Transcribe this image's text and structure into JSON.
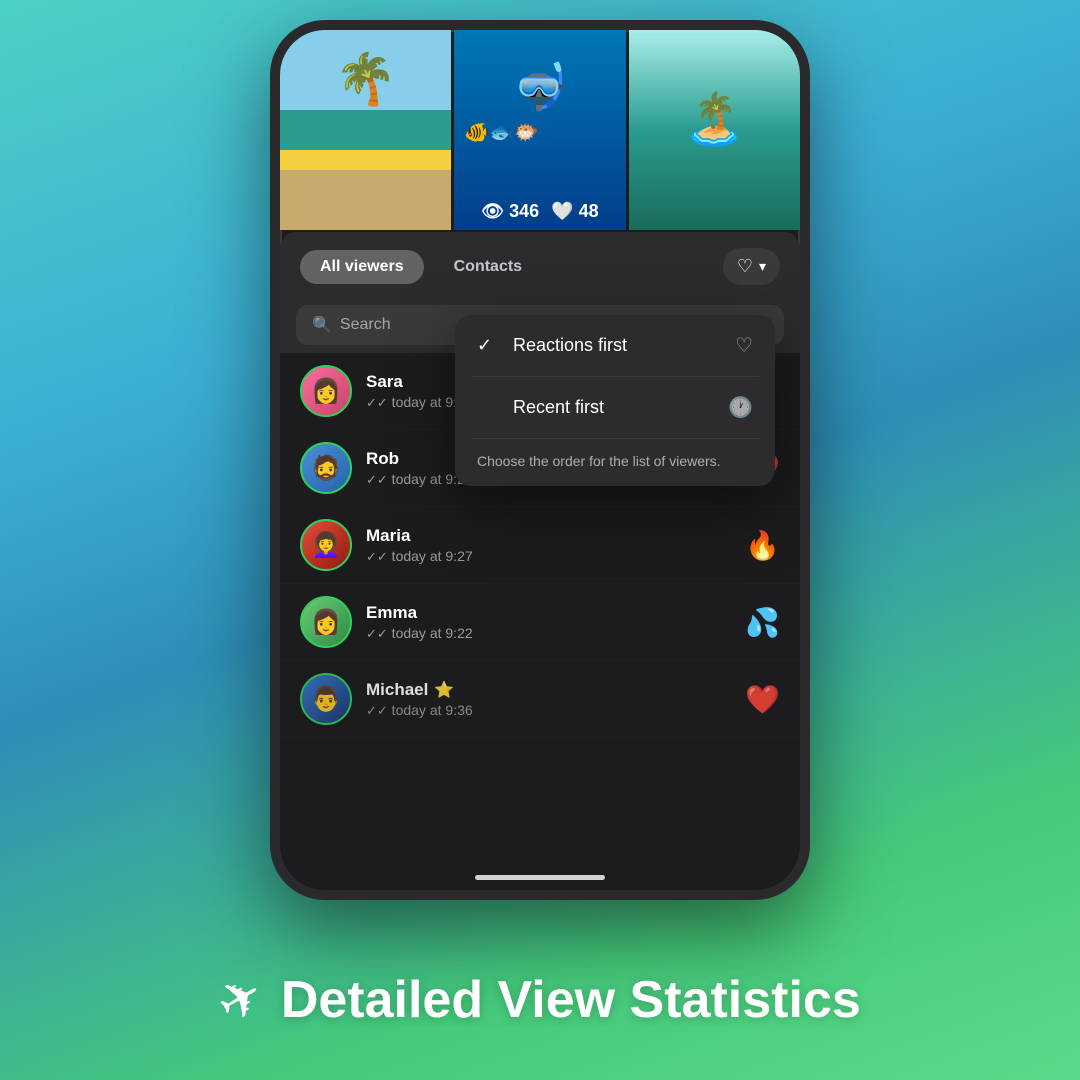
{
  "background": {
    "gradient_start": "#4ecdc4",
    "gradient_end": "#5bd98a"
  },
  "phone": {
    "media": {
      "items": [
        {
          "type": "beach",
          "label": "beach-scene"
        },
        {
          "type": "underwater",
          "label": "underwater-scene"
        },
        {
          "type": "island",
          "label": "island-scene"
        }
      ],
      "stats": {
        "views_icon": "👁",
        "views_count": "346",
        "likes_icon": "🤍",
        "likes_count": "48"
      }
    },
    "tabs": {
      "all_viewers_label": "All viewers",
      "contacts_label": "Contacts",
      "filter_icon": "♡"
    },
    "search": {
      "placeholder": "Search",
      "icon": "🔍"
    },
    "viewers": [
      {
        "name": "Sara",
        "time": "today at 9:41",
        "reaction": "",
        "has_reaction": false,
        "avatar_type": "sara"
      },
      {
        "name": "Rob",
        "time": "today at 9:27",
        "reaction": "❤️",
        "has_reaction": true,
        "avatar_type": "rob"
      },
      {
        "name": "Maria",
        "time": "today at 9:27",
        "reaction": "🔥",
        "has_reaction": true,
        "avatar_type": "maria"
      },
      {
        "name": "Emma",
        "time": "today at 9:22",
        "reaction": "💧",
        "has_reaction": true,
        "avatar_type": "emma"
      },
      {
        "name": "Michael",
        "time": "today at 9:36",
        "reaction": "❤️",
        "has_reaction": true,
        "avatar_type": "michael",
        "badge": "⭐"
      }
    ]
  },
  "dropdown": {
    "items": [
      {
        "id": "reactions-first",
        "label": "Reactions first",
        "icon": "♡",
        "selected": true
      },
      {
        "id": "recent-first",
        "label": "Recent first",
        "icon": "🕐",
        "selected": false
      }
    ],
    "description": "Choose the order for the list of viewers."
  },
  "bottom": {
    "telegram_icon": "✈",
    "title": "Detailed View Statistics"
  }
}
